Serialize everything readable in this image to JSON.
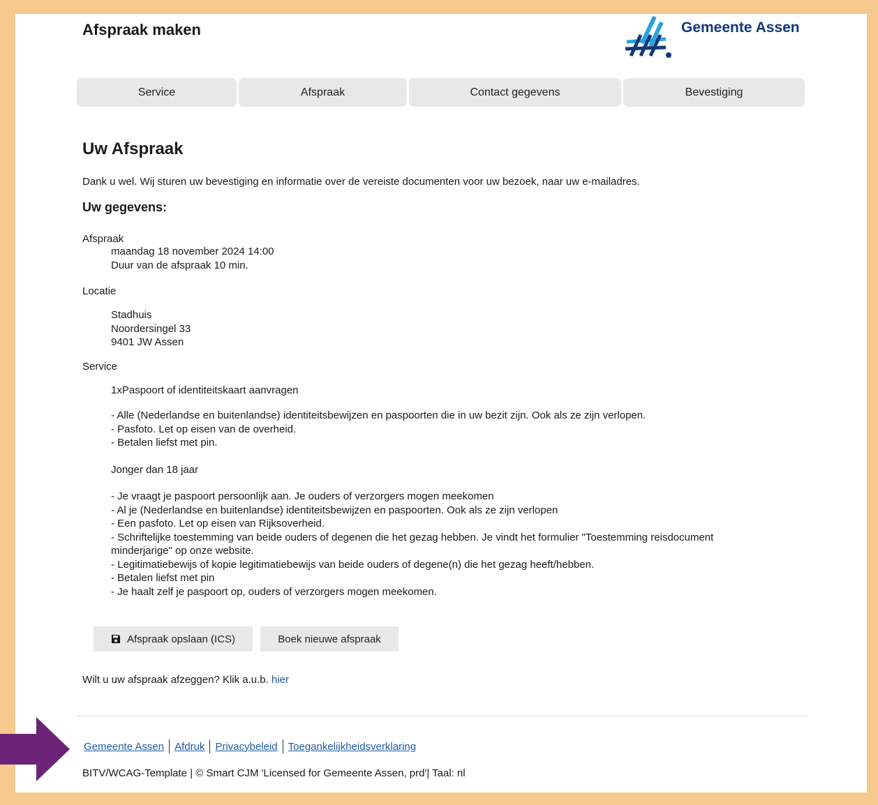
{
  "header": {
    "title": "Afspraak maken",
    "logo_text": "Gemeente Assen",
    "logo_colors": {
      "dark": "#13387a",
      "light": "#29a3dd"
    }
  },
  "steps": [
    {
      "label": "Service"
    },
    {
      "label": "Afspraak"
    },
    {
      "label": "Contact gegevens"
    },
    {
      "label": "Bevestiging"
    }
  ],
  "main": {
    "heading": "Uw Afspraak",
    "intro": "Dank u wel. Wij sturen uw bevestiging en informatie over de vereiste documenten voor uw bezoek, naar uw e-mailadres.",
    "details_heading": "Uw gegevens:",
    "appointment": {
      "label": "Afspraak",
      "datetime": "maandag 18 november 2024 14:00",
      "duration": "Duur van de afspraak 10 min."
    },
    "location": {
      "label": "Locatie",
      "name": "Stadhuis",
      "street": "Noordersingel 33",
      "postal": "9401 JW Assen"
    },
    "service": {
      "label": "Service",
      "name": "1xPaspoort of identiteitskaart aanvragen",
      "requirements": [
        "- Alle (Nederlandse en buitenlandse) identiteitsbewijzen en paspoorten die in uw bezit zijn. Ook als ze zijn verlopen.",
        "- Pasfoto. Let op eisen van de overheid.",
        "- Betalen liefst met pin."
      ],
      "minor_heading": "Jonger dan 18 jaar",
      "minor_requirements": [
        "- Je vraagt je paspoort persoonlijk aan. Je ouders of verzorgers mogen meekomen",
        "- Al je (Nederlandse en buitenlandse) identiteitsbewijzen en paspoorten. Ook als ze zijn verlopen",
        "- Een pasfoto. Let op eisen van Rijksoverheid.",
        "- Schriftelijke toestemming van beide ouders of degenen die het gezag hebben. Je vindt het formulier \"Toestemming reisdocument minderjarige\" op onze website.",
        "- Legitimatiebewijs of kopie legitimatiebewijs van beide ouders of degene(n) die het gezag heeft/hebben.",
        "- Betalen liefst met pin",
        "- Je haalt zelf je paspoort op, ouders of verzorgers mogen meekomen."
      ]
    },
    "buttons": {
      "save_ics": "Afspraak opslaan (ICS)",
      "new_booking": "Boek nieuwe afspraak"
    },
    "cancel_text": "Wilt u uw afspraak afzeggen? Klik a.u.b. ",
    "cancel_link": "hier"
  },
  "footer": {
    "links": [
      "Gemeente Assen",
      "Afdruk",
      "Privacybeleid",
      "Toegankelijkheidsverklaring"
    ],
    "credit": "BITV/WCAG-Template | © Smart CJM 'Licensed for Gemeente Assen, prd'| Taal: nl"
  },
  "annotation": {
    "icon": "arrow-right-icon",
    "color": "#6b2477"
  },
  "colors": {
    "frame": "#f6c98f",
    "step_bg": "#e8e8e8",
    "link": "#1f5aa6"
  }
}
